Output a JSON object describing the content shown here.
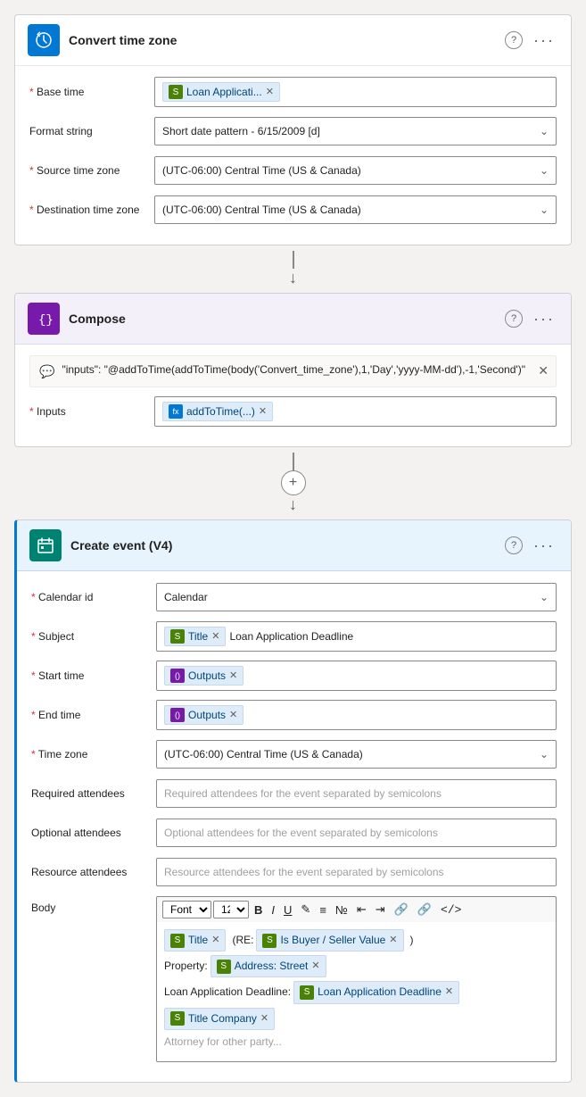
{
  "convertTimeZone": {
    "title": "Convert time zone",
    "headerIconAlt": "clock-icon",
    "fields": {
      "baseTime": {
        "label": "Base time",
        "required": true,
        "token": {
          "icon": "green",
          "text": "Loan Applicati..."
        }
      },
      "formatString": {
        "label": "Format string",
        "required": false,
        "value": "Short date pattern - 6/15/2009 [d]"
      },
      "sourceTimeZone": {
        "label": "Source time zone",
        "required": true,
        "value": "(UTC-06:00) Central Time (US & Canada)"
      },
      "destinationTimeZone": {
        "label": "Destination time zone",
        "required": true,
        "value": "(UTC-06:00) Central Time (US & Canada)"
      }
    }
  },
  "compose": {
    "title": "Compose",
    "headerIconAlt": "code-icon",
    "hint": "\"inputs\": \"@addToTime(addToTime(body('Convert_time_zone'),1,'Day','yyyy-MM-dd'),-1,'Second')\"",
    "fields": {
      "inputs": {
        "label": "Inputs",
        "required": true,
        "token": {
          "icon": "blue",
          "text": "addToTime(...)"
        }
      }
    }
  },
  "createEvent": {
    "title": "Create event (V4)",
    "headerIconAlt": "calendar-icon",
    "fields": {
      "calendarId": {
        "label": "Calendar id",
        "required": true,
        "value": "Calendar"
      },
      "subject": {
        "label": "Subject",
        "required": true,
        "token": {
          "icon": "green",
          "text": "Title"
        },
        "extraText": "Loan Application Deadline"
      },
      "startTime": {
        "label": "Start time",
        "required": true,
        "token": {
          "icon": "purple",
          "text": "Outputs"
        }
      },
      "endTime": {
        "label": "End time",
        "required": true,
        "token": {
          "icon": "purple",
          "text": "Outputs"
        }
      },
      "timeZone": {
        "label": "Time zone",
        "required": true,
        "value": "(UTC-06:00) Central Time (US & Canada)"
      },
      "requiredAttendees": {
        "label": "Required attendees",
        "required": false,
        "placeholder": "Required attendees for the event separated by semicolons"
      },
      "optionalAttendees": {
        "label": "Optional attendees",
        "required": false,
        "placeholder": "Optional attendees for the event separated by semicolons"
      },
      "resourceAttendees": {
        "label": "Resource attendees",
        "required": false,
        "placeholder": "Resource attendees for the event separated by semicolons"
      },
      "body": {
        "label": "Body",
        "required": false
      }
    },
    "bodyContent": {
      "toolbar": {
        "font": "Font",
        "size": "12"
      },
      "lines": [
        {
          "parts": [
            {
              "type": "token",
              "icon": "green",
              "text": "Title"
            },
            {
              "type": "text",
              "text": "(RE:"
            },
            {
              "type": "token",
              "icon": "green",
              "text": "Is Buyer / Seller Value"
            },
            {
              "type": "text",
              "text": ")"
            }
          ]
        },
        {
          "parts": [
            {
              "type": "text",
              "text": "Property:"
            },
            {
              "type": "token",
              "icon": "green",
              "text": "Address: Street"
            }
          ]
        },
        {
          "parts": [
            {
              "type": "text",
              "text": "Loan Application Deadline:"
            },
            {
              "type": "token",
              "icon": "green",
              "text": "Loan Application Deadline"
            }
          ]
        },
        {
          "parts": [
            {
              "type": "token",
              "icon": "green",
              "text": "Title Company"
            }
          ]
        },
        {
          "parts": [
            {
              "type": "text",
              "text": "Attorney for other party..."
            }
          ]
        }
      ]
    }
  },
  "labels": {
    "questionMark": "?",
    "dotsMenu": "···",
    "closeX": "✕",
    "dropdownArrow": "∨",
    "addConnector": "+"
  }
}
